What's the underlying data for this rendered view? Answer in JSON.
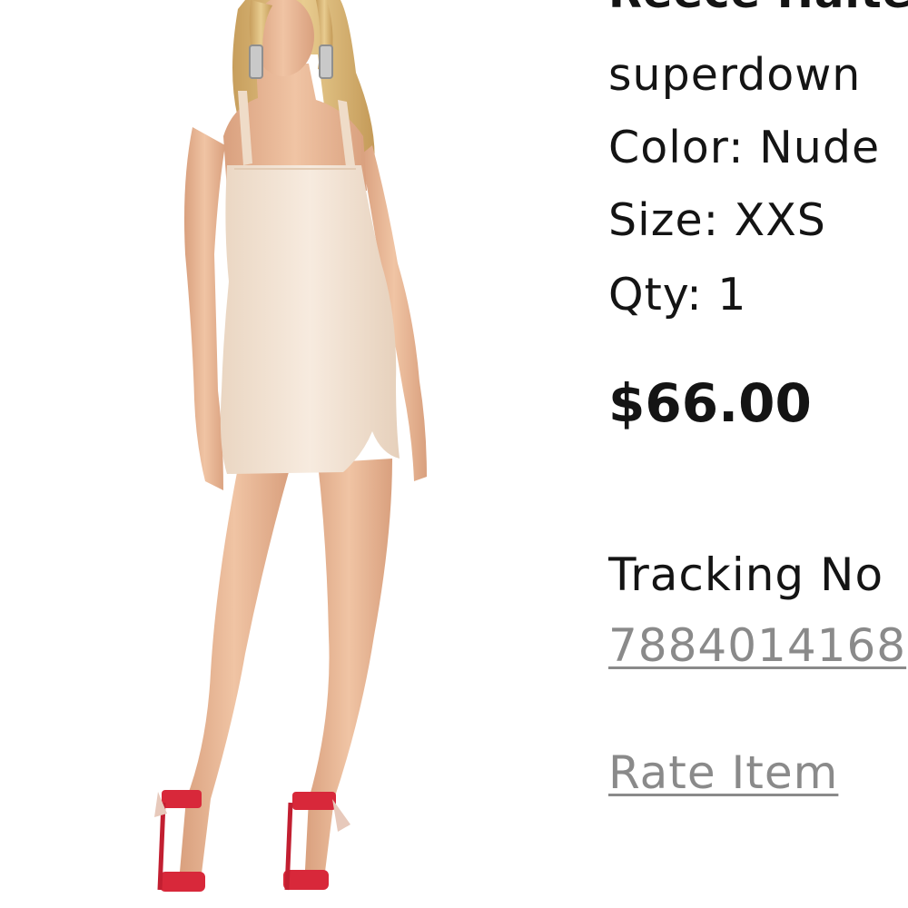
{
  "product": {
    "name": "Reece Halter",
    "brand": "superdown",
    "color": "Color: Nude",
    "size": "Size: XXS",
    "qty": "Qty: 1",
    "price": "$66.00"
  },
  "tracking": {
    "label": "Tracking No",
    "number": "7884014168"
  },
  "actions": {
    "rate_item": "Rate Item"
  },
  "colors": {
    "text": "#141414",
    "link": "#8a8a8a",
    "dress": "#f2e2d2",
    "skin": "#e8b896",
    "hair": "#d9b878",
    "heels": "#d8283a"
  }
}
